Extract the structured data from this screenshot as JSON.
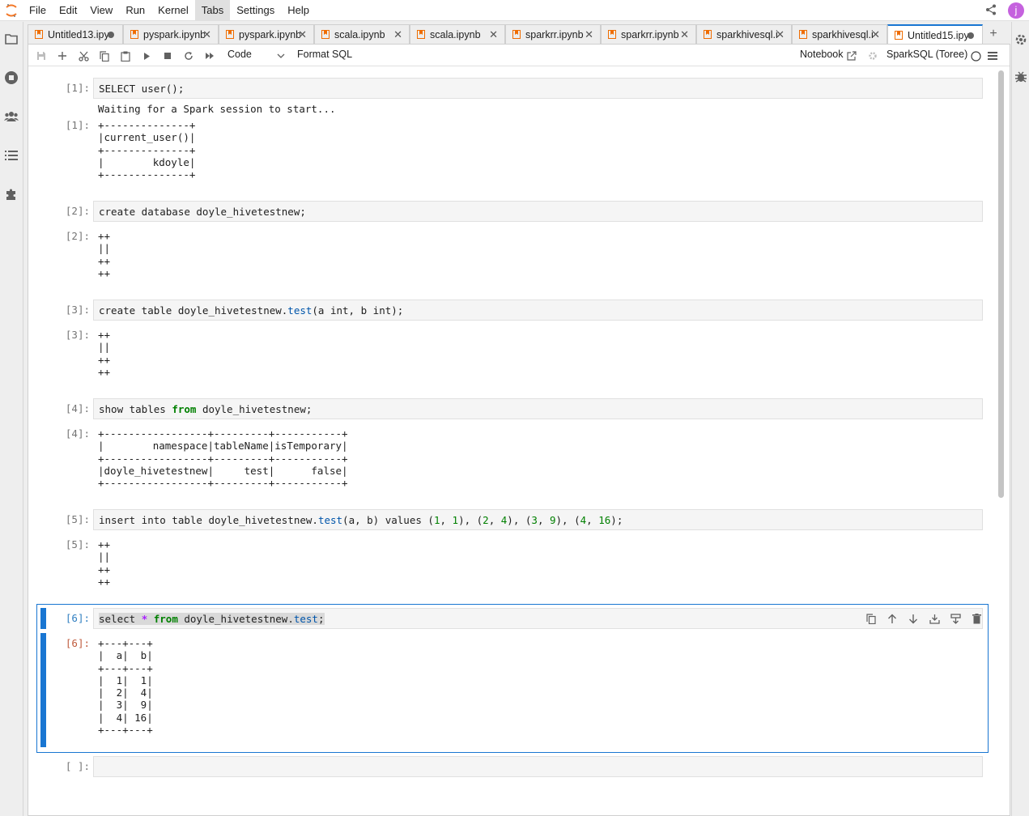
{
  "menu": {
    "items": [
      "File",
      "Edit",
      "View",
      "Run",
      "Kernel",
      "Tabs",
      "Settings",
      "Help"
    ],
    "active": "Tabs",
    "user_initial": "j"
  },
  "tabs": [
    {
      "label": "Untitled13.ipynb",
      "state": "dirty"
    },
    {
      "label": "pyspark.ipynb",
      "state": "close"
    },
    {
      "label": "pyspark.ipynb",
      "state": "close"
    },
    {
      "label": "scala.ipynb",
      "state": "close"
    },
    {
      "label": "scala.ipynb",
      "state": "close"
    },
    {
      "label": "sparkrr.ipynb",
      "state": "close"
    },
    {
      "label": "sparkrr.ipynb",
      "state": "close"
    },
    {
      "label": "sparkhivesql.ipynb",
      "state": "close"
    },
    {
      "label": "sparkhivesql.ipynb",
      "state": "close"
    },
    {
      "label": "Untitled15.ipynb",
      "state": "dirty",
      "current": true
    }
  ],
  "toolbar": {
    "cell_type": "Code",
    "format_label": "Format SQL",
    "notebook_label": "Notebook",
    "kernel_name": "SparkSQL (Toree)"
  },
  "cells": {
    "c1": {
      "prompt_in": "[1]:",
      "prompt_out": "[1]:",
      "code": "SELECT user();",
      "stream": "Waiting for a Spark session to start...",
      "output": "+--------------+\n|current_user()|\n+--------------+\n|        kdoyle|\n+--------------+"
    },
    "c2": {
      "prompt_in": "[2]:",
      "prompt_out": "[2]:",
      "code": "create database doyle_hivetestnew;",
      "output": "++\n||\n++\n++"
    },
    "c3": {
      "prompt_in": "[3]:",
      "prompt_out": "[3]:",
      "code_a": "create table doyle_hivetestnew.",
      "code_prop": "test",
      "code_b": "(a int, b int);",
      "output": "++\n||\n++\n++"
    },
    "c4": {
      "prompt_in": "[4]:",
      "prompt_out": "[4]:",
      "code_a": "show tables ",
      "code_kw": "from",
      "code_b": " doyle_hivetestnew;",
      "output": "+-----------------+---------+-----------+\n|        namespace|tableName|isTemporary|\n+-----------------+---------+-----------+\n|doyle_hivetestnew|     test|      false|\n+-----------------+---------+-----------+"
    },
    "c5": {
      "prompt_in": "[5]:",
      "prompt_out": "[5]:",
      "code_a": "insert into table doyle_hivetestnew.",
      "code_prop": "test",
      "code_b": "(a, b) values (",
      "n1": "1",
      "n2": "1",
      "n3": "2",
      "n4": "4",
      "n5": "3",
      "n6": "9",
      "n7": "4",
      "n8": "16",
      "output": "++\n||\n++\n++"
    },
    "c6": {
      "prompt_in": "[6]:",
      "prompt_out": "[6]:",
      "code_a": "select ",
      "code_op": "*",
      "code_kw": "from",
      "code_b": " doyle_hivetestnew.",
      "code_prop": "test",
      "code_end": ";",
      "output": "+---+---+\n|  a|  b|\n+---+---+\n|  1|  1|\n|  2|  4|\n|  3|  9|\n|  4| 16|\n+---+---+"
    },
    "c7": {
      "prompt_in": "[ ]:"
    }
  }
}
